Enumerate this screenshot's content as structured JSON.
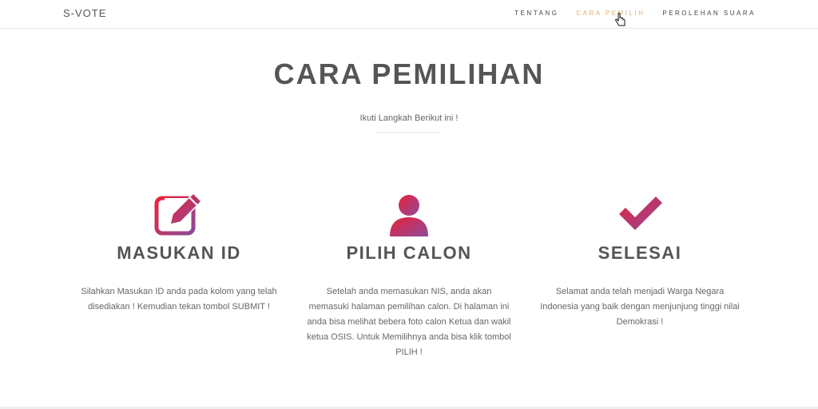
{
  "navbar": {
    "brand": "S-VOTE",
    "links": [
      {
        "label": "TENTANG",
        "active": false
      },
      {
        "label": "CARA PEMILIH",
        "active": true
      },
      {
        "label": "PEROLEHAN SUARA",
        "active": false
      }
    ]
  },
  "hero": {
    "title": "CARA PEMILIHAN",
    "subtitle": "Ikuti Langkah Berikut ini !"
  },
  "steps": [
    {
      "icon": "edit-icon",
      "title": "MASUKAN ID",
      "description": "Silahkan Masukan ID anda pada kolom yang telah disediakan ! Kemudian tekan tombol SUBMIT !"
    },
    {
      "icon": "user-icon",
      "title": "PILIH CALON",
      "description": "Setelah anda memasukan NIS, anda akan memasuki halaman pemilihan calon. Di halaman ini anda bisa melihat bebera foto calon Ketua dan wakil ketua OSIS. Untuk Memilihnya anda bisa klik tombol PILIH !"
    },
    {
      "icon": "check-icon",
      "title": "SELESAI",
      "description": "Selamat anda telah menjadi Warga Negara Indonesia yang baik dengan menjunjung tinggi nilai Demokrasi !"
    }
  ],
  "colors": {
    "icon_gradient_start": "#e8223a",
    "icon_gradient_end": "#8e4a9a",
    "nav_active": "#e0b070"
  }
}
